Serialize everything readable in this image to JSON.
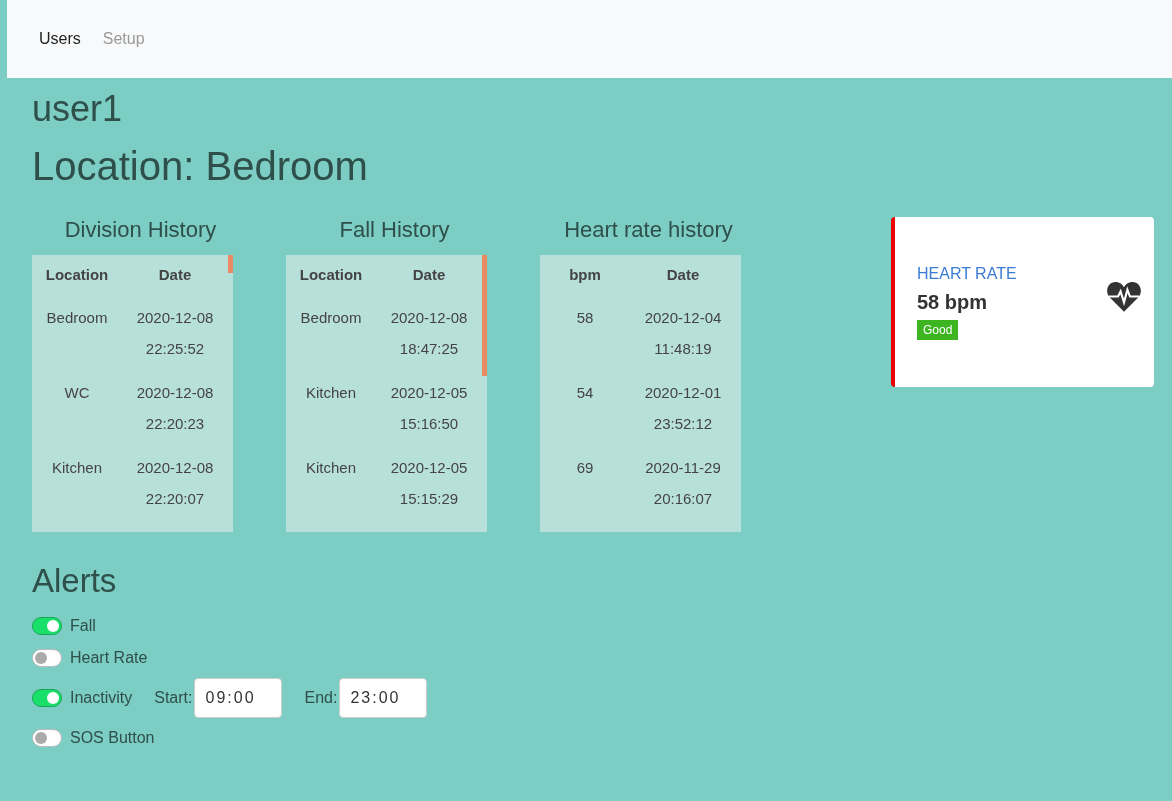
{
  "nav": [
    {
      "label": "Users",
      "selected": true
    },
    {
      "label": "Setup",
      "selected": false
    }
  ],
  "user": "user1",
  "location": "Location: Bedroom",
  "tables": [
    {
      "title": "Division History",
      "scrollbar": true,
      "columns": [
        "Location",
        "Date"
      ],
      "rows": [
        [
          "Bedroom",
          "2020-12-08 22:25:52"
        ],
        [
          "WC",
          "2020-12-08 22:20:23"
        ],
        [
          "Kitchen",
          "2020-12-08 22:20:07"
        ]
      ]
    },
    {
      "title": "Fall History",
      "scrollbar": true,
      "columns": [
        "Location",
        "Date"
      ],
      "rows": [
        [
          "Bedroom",
          "2020-12-08 18:47:25"
        ],
        [
          "Kitchen",
          "2020-12-05 15:16:50"
        ],
        [
          "Kitchen",
          "2020-12-05 15:15:29"
        ]
      ]
    },
    {
      "title": "Heart rate history",
      "scrollbar": false,
      "columns": [
        "bpm",
        "Date"
      ],
      "rows": [
        [
          "58",
          "2020-12-04 11:48:19"
        ],
        [
          "54",
          "2020-12-01 23:52:12"
        ],
        [
          "69",
          "2020-11-29 20:16:07"
        ]
      ]
    }
  ],
  "card": {
    "title": "HEART RATE",
    "value": "58 bpm",
    "status": "Good"
  },
  "alerts": {
    "title": "Alerts",
    "items": [
      {
        "label": "Fall",
        "on": true
      },
      {
        "label": "Heart Rate",
        "on": false
      },
      {
        "label": "Inactivity",
        "on": true,
        "start": {
          "label": "Start:",
          "value": "09:00"
        },
        "end": {
          "label": "End:",
          "value": "23:00"
        }
      },
      {
        "label": "SOS Button",
        "on": false
      }
    ]
  }
}
